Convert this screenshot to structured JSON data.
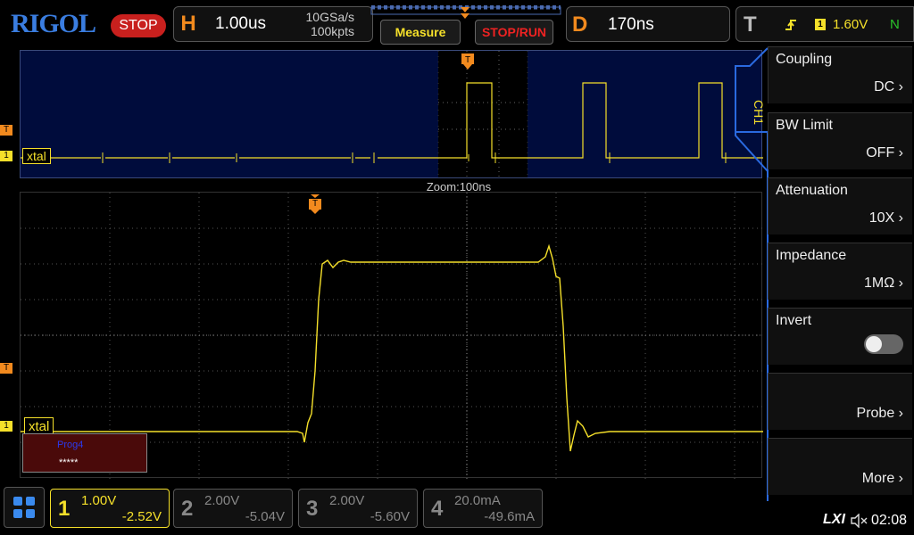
{
  "brand": "RIGOL",
  "run_state": "STOP",
  "horizontal": {
    "letter": "H",
    "timebase": "1.00us",
    "sample_rate": "10GSa/s",
    "memory": "100kpts"
  },
  "buttons": {
    "measure": "Measure",
    "stop_run": "STOP/RUN"
  },
  "delay": {
    "letter": "D",
    "value": "170ns"
  },
  "trigger": {
    "letter": "T",
    "source": "1",
    "level": "1.60V",
    "mode": "N"
  },
  "overview": {
    "channel_label": "xtal",
    "marker_T": "T",
    "marker_1": "1"
  },
  "zoom_label": "Zoom:100ns",
  "main": {
    "channel_label": "xtal",
    "trigger_marker": "T",
    "marker_T": "T",
    "marker_1": "1"
  },
  "decoder": {
    "name": "Prog4",
    "value": "*****"
  },
  "side_menu": {
    "tab": "CH1",
    "items": [
      {
        "title": "Coupling",
        "value": "DC"
      },
      {
        "title": "BW Limit",
        "value": "OFF"
      },
      {
        "title": "Attenuation",
        "value": "10X"
      },
      {
        "title": "Impedance",
        "value": "1MΩ"
      },
      {
        "title": "Invert",
        "value": ""
      },
      {
        "title": "",
        "value": "Probe"
      },
      {
        "title": "",
        "value": "More"
      }
    ],
    "invert_on": false
  },
  "channels": [
    {
      "num": "1",
      "scale": "1.00V",
      "offset": "-2.52V",
      "active": true,
      "color": "#f5e02a"
    },
    {
      "num": "2",
      "scale": "2.00V",
      "offset": "-5.04V",
      "active": false,
      "color": "#888888"
    },
    {
      "num": "3",
      "scale": "2.00V",
      "offset": "-5.60V",
      "active": false,
      "color": "#888888"
    },
    {
      "num": "4",
      "scale": "20.0mA",
      "offset": "-49.6mA",
      "active": false,
      "color": "#888888"
    }
  ],
  "status": {
    "lxi": "LXI",
    "time": "02:08"
  },
  "colors": {
    "ch1": "#f5e02a",
    "trigger": "#f28a1e",
    "brand": "#3a7de0",
    "stop": "#c8201e"
  }
}
